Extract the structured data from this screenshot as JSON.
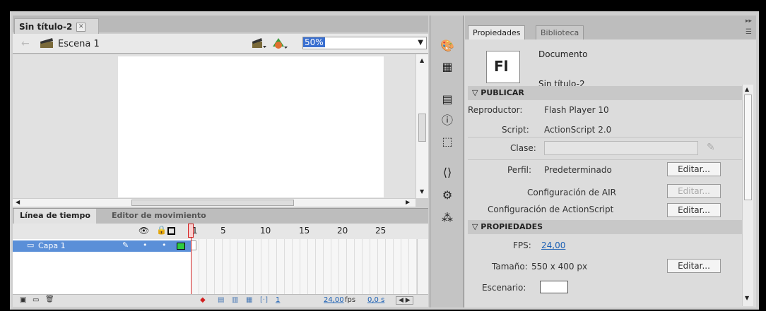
{
  "document_tab": {
    "title": "Sin título-2"
  },
  "scene": {
    "name": "Escena 1",
    "zoom": "50%"
  },
  "timeline": {
    "tabs": [
      "Línea de tiempo",
      "Editor de movimiento"
    ],
    "frame_numbers": [
      "1",
      "5",
      "10",
      "15",
      "20",
      "25"
    ],
    "layer_name": "Capa 1",
    "footer": {
      "frame": "1",
      "fps": "24,00",
      "fps_unit": "fps",
      "time": "0,0 s"
    }
  },
  "properties": {
    "tabs": [
      "Propiedades",
      "Biblioteca"
    ],
    "doc_icon": "Fl",
    "doc_type": "Documento",
    "doc_name": "Sin título-2",
    "publish_section": "PUBLICAR",
    "player_label": "Reproductor:",
    "player_value": "Flash Player 10",
    "script_label": "Script:",
    "script_value": "ActionScript 2.0",
    "class_label": "Clase:",
    "profile_label": "Perfil:",
    "profile_value": "Predeterminado",
    "edit_label": "Editar...",
    "air_label": "Configuración de AIR",
    "as_label": "Configuración de ActionScript",
    "properties_section": "PROPIEDADES",
    "fps_label": "FPS:",
    "fps_value": "24,00",
    "size_label": "Tamaño:",
    "size_value": "550 x 400 px",
    "stage_label": "Escenario:"
  },
  "colors": {
    "accent": "#5a8fd8",
    "playhead": "#d22020",
    "stage_color": "#ffffff"
  }
}
